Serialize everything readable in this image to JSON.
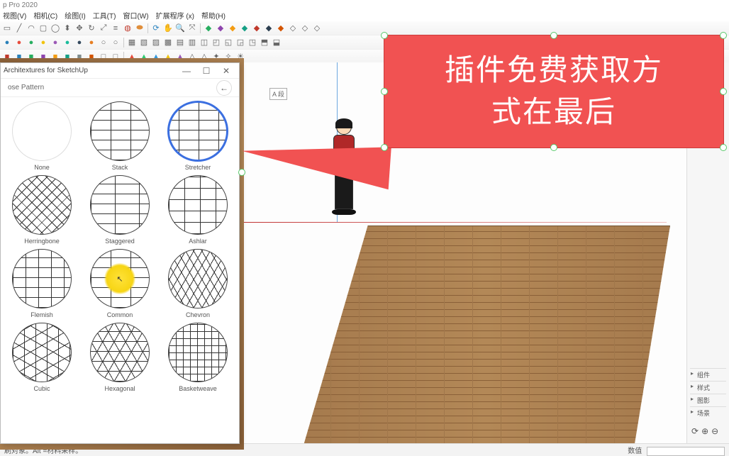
{
  "app": {
    "title": "p Pro 2020"
  },
  "menu": [
    "视图(V)",
    "相机(C)",
    "绘图(I)",
    "工具(T)",
    "窗口(W)",
    "扩展程序 (x)",
    "帮助(H)"
  ],
  "dialog": {
    "title": "Architextures for SketchUp",
    "subtitle": "ose Pattern",
    "min": "—",
    "max": "☐",
    "close": "✕",
    "back": "←"
  },
  "patterns": [
    "None",
    "Stack",
    "Stretcher",
    "Herringbone",
    "Staggered",
    "Ashlar",
    "Flemish",
    "Common",
    "Chevron",
    "Cubic",
    "Hexagonal",
    "Basketweave"
  ],
  "callout": {
    "line1": "插件免费获取方",
    "line2": "式在最后"
  },
  "status": {
    "left": "刷对象。Alt =材料采样。",
    "rlabel": "数值"
  },
  "rightPanels": [
    "组件",
    "样式",
    "图影",
    "场景"
  ],
  "vpBadge": "A 段",
  "colors": {
    "accent": "#f15252",
    "select": "#3b6fe0",
    "wood1": "#a57a4d",
    "wood2": "#8a6038"
  }
}
